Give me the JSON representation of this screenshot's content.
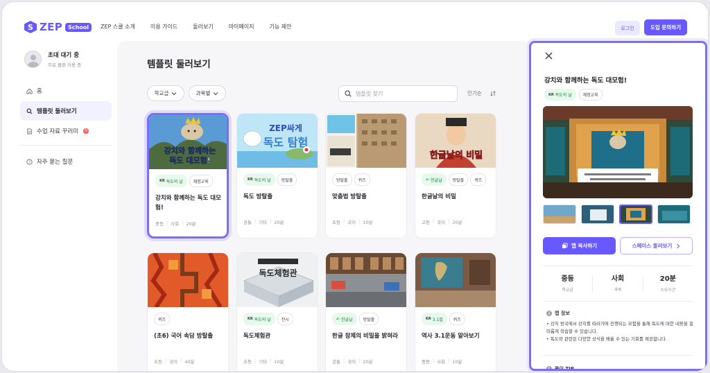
{
  "brand": {
    "logo_text": "ZEP",
    "badge": "School",
    "accent": "#6758ff"
  },
  "nav": [
    "ZEP 스쿨 소개",
    "이용 가이드",
    "둘러보기",
    "마이페이지",
    "기능 제안"
  ],
  "header_actions": {
    "login": "로그인",
    "inquiry": "도입 문의하기"
  },
  "profile": {
    "name": "초대 대기 중",
    "plan": "무료 플랜 이용 중"
  },
  "sidebar": {
    "items": [
      {
        "label": "홈",
        "icon": "home-icon"
      },
      {
        "label": "템플릿 둘러보기",
        "icon": "search-icon",
        "active": true
      },
      {
        "label": "수업 자료 꾸러미",
        "icon": "document-icon",
        "badge": "N"
      }
    ],
    "faq": {
      "label": "자주 묻는 질문",
      "icon": "help-icon"
    }
  },
  "main": {
    "title": "템플릿 둘러보기",
    "filters": [
      "학교급",
      "과목별"
    ],
    "search_placeholder": "템플릿 찾기",
    "sort": "인기순"
  },
  "cards": [
    {
      "tags": [
        {
          "text": "독도의 날",
          "flag": "KR",
          "style": "green"
        },
        {
          "text": "체험교육"
        }
      ],
      "title": "강치와 함께하는 독도 대모험!",
      "meta": [
        "중등",
        "사회",
        "20분"
      ],
      "selected": true
    },
    {
      "tags": [
        {
          "text": "독도의 날",
          "flag": "KR",
          "style": "green"
        },
        {
          "text": "방탈출"
        }
      ],
      "title": "독도 방탈출",
      "meta": [
        "공통",
        "기타",
        "20분"
      ]
    },
    {
      "tags": [
        {
          "text": "방탈출"
        },
        {
          "text": "퀴즈"
        }
      ],
      "title": "맞춤법 방탈출",
      "meta": [
        "초등",
        "국어",
        "10분"
      ]
    },
    {
      "tags": [
        {
          "text": "한글날",
          "flag": "✍",
          "style": "green"
        },
        {
          "text": "방탈출"
        },
        {
          "text": "퀴즈"
        }
      ],
      "title": "한글날의 비밀",
      "meta": [
        "고등",
        "국어",
        "20분"
      ]
    },
    {
      "tags": [
        {
          "text": "퀴즈"
        }
      ],
      "title": "(초6) 국어 속담 방탈출",
      "meta": [
        "초등",
        "국어",
        "40분"
      ]
    },
    {
      "tags": [
        {
          "text": "독도의 날",
          "flag": "KR",
          "style": "green"
        },
        {
          "text": "전시"
        }
      ],
      "title": "독도체험관",
      "meta": [
        "초등",
        "기타",
        "10분"
      ]
    },
    {
      "tags": [
        {
          "text": "한글날",
          "flag": "✍",
          "style": "green"
        },
        {
          "text": "방탈출"
        }
      ],
      "title": "한글 창제의 비밀을 밝혀라",
      "meta": [
        "공통",
        "국어",
        "20분"
      ]
    },
    {
      "tags": [
        {
          "text": "3.1절",
          "flag": "KR",
          "style": "green"
        },
        {
          "text": "퀴즈"
        }
      ],
      "title": "역사 3.1운동 알아보기",
      "meta": [
        "중등",
        "사회",
        "10분"
      ]
    }
  ],
  "thumb_texts": {
    "card1": "강치와 함께하는 독도 대모험",
    "card2": "ZEP싸게 독도 탐험",
    "card4": "한글날의 비밀",
    "card6": "독도체험관"
  },
  "detail": {
    "title": "강치와 함께하는 독도 대모험!",
    "tags": [
      {
        "text": "독도의 날",
        "flag": "KR",
        "style": "green"
      },
      {
        "text": "체험교육"
      }
    ],
    "copy_button": "맵 복사하기",
    "browse_button": "스페이스 둘러보기",
    "stats": [
      {
        "value": "중등",
        "label": "학교급"
      },
      {
        "value": "사회",
        "label": "과목"
      },
      {
        "value": "20분",
        "label": "소요시간"
      }
    ],
    "info_title": "맵 정보",
    "info_lines": [
      "• 강치 왕국에서 강치를 따라가며 진행되는 모험을 통해 독도에 대한 내용을 흥미롭게 학습할 수 있습니다.",
      "• 독도와 관련된 다양한 상식을 배울 수 있는 기회를 제공합니다."
    ],
    "tip_title": "풀이 TIP"
  }
}
